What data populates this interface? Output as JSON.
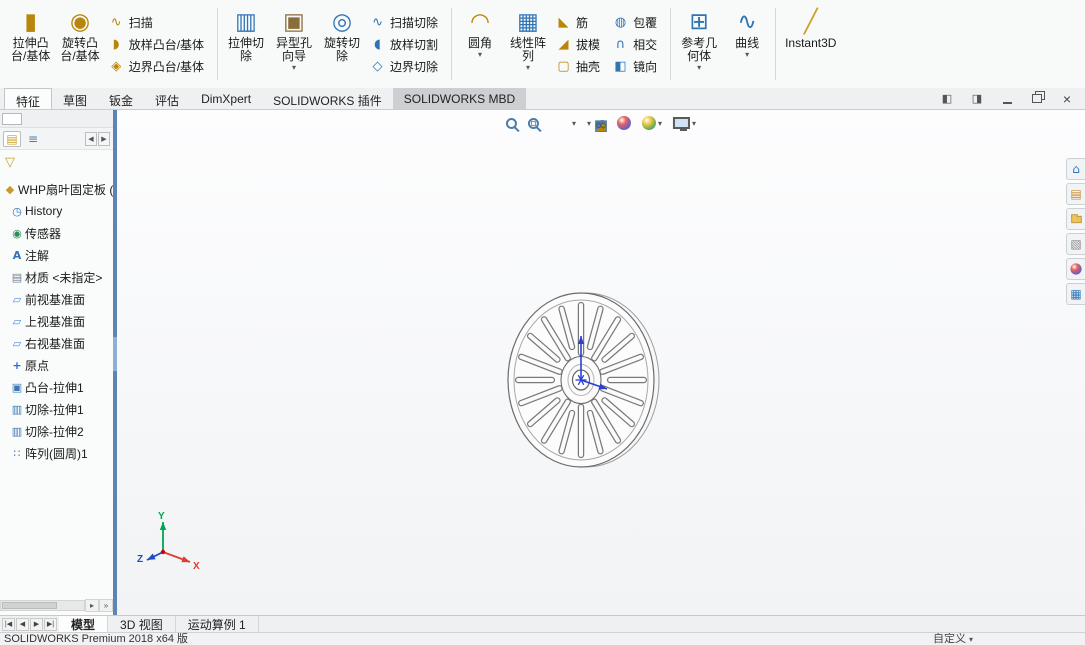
{
  "icons": {
    "filter": "▽",
    "spin_left": "◀",
    "spin_right": "▶",
    "hscroll_right": "▸",
    "overflow": "»",
    "caret": "▾"
  },
  "ribbon": {
    "groups": [
      [
        {
          "kind": "large",
          "id": "extruded-boss",
          "lines": [
            "拉伸凸",
            "台/基体"
          ],
          "glyph": "▮",
          "color": "#b8860b"
        },
        {
          "kind": "large",
          "id": "revolved-boss",
          "lines": [
            "旋转凸",
            "台/基体"
          ],
          "glyph": "◉",
          "color": "#b8860b"
        },
        {
          "kind": "stack",
          "items": [
            {
              "id": "swept-boss",
              "label": "扫描",
              "glyph": "∿",
              "color": "#b8860b"
            },
            {
              "id": "lofted-boss",
              "label": "放样凸台/基体",
              "glyph": "◗",
              "color": "#b8860b"
            },
            {
              "id": "boundary-boss",
              "label": "边界凸台/基体",
              "glyph": "◈",
              "color": "#b8860b"
            }
          ]
        }
      ],
      [
        {
          "kind": "large",
          "id": "extruded-cut",
          "lines": [
            "拉伸切",
            "除"
          ],
          "glyph": "▥",
          "color": "#2e75b6"
        },
        {
          "kind": "large",
          "id": "hole-wizard",
          "lines": [
            "异型孔",
            "向导"
          ],
          "glyph": "▣",
          "color": "#8a6d3b",
          "caret": true
        },
        {
          "kind": "large",
          "id": "revolved-cut",
          "lines": [
            "旋转切",
            "除"
          ],
          "glyph": "◎",
          "color": "#2e75b6"
        },
        {
          "kind": "stack",
          "items": [
            {
              "id": "swept-cut",
              "label": "扫描切除",
              "glyph": "∿",
              "color": "#2e75b6"
            },
            {
              "id": "lofted-cut",
              "label": "放样切割",
              "glyph": "◖",
              "color": "#2e75b6"
            },
            {
              "id": "boundary-cut",
              "label": "边界切除",
              "glyph": "◇",
              "color": "#2e75b6"
            }
          ]
        }
      ],
      [
        {
          "kind": "large",
          "id": "fillet",
          "lines": [
            "圆角"
          ],
          "glyph": "◠",
          "color": "#b8860b",
          "caret": true
        },
        {
          "kind": "large",
          "id": "linear-pattern",
          "lines": [
            "线性阵",
            "列"
          ],
          "glyph": "▦",
          "color": "#2e75b6",
          "caret": true
        },
        {
          "kind": "stack",
          "items": [
            {
              "id": "rib",
              "label": "筋",
              "glyph": "◣",
              "color": "#b8860b"
            },
            {
              "id": "draft",
              "label": "拔模",
              "glyph": "◢",
              "color": "#b8860b"
            },
            {
              "id": "shell",
              "label": "抽壳",
              "glyph": "▢",
              "color": "#b8860b"
            }
          ]
        },
        {
          "kind": "stack",
          "items": [
            {
              "id": "wrap",
              "label": "包覆",
              "glyph": "◍",
              "color": "#2e75b6"
            },
            {
              "id": "intersect",
              "label": "相交",
              "glyph": "∩",
              "color": "#2e75b6"
            },
            {
              "id": "mirror",
              "label": "镜向",
              "glyph": "◧",
              "color": "#2e75b6"
            }
          ]
        }
      ],
      [
        {
          "kind": "large",
          "id": "reference-geometry",
          "lines": [
            "参考几",
            "何体"
          ],
          "glyph": "⊞",
          "color": "#2e75b6",
          "caret": true
        },
        {
          "kind": "large",
          "id": "curves",
          "lines": [
            "曲线"
          ],
          "glyph": "∿",
          "color": "#2e75b6",
          "caret": true
        }
      ],
      [
        {
          "kind": "large",
          "id": "instant3d",
          "lines": [
            "Instant3D"
          ],
          "glyph": "╱",
          "color": "#c9a227"
        }
      ]
    ]
  },
  "tab_bar": {
    "active": 0,
    "tabs": [
      {
        "id": "features",
        "label": "特征"
      },
      {
        "id": "sketch",
        "label": "草图"
      },
      {
        "id": "sheet-metal",
        "label": "钣金"
      },
      {
        "id": "evaluate",
        "label": "评估"
      },
      {
        "id": "dimxpert",
        "label": "DimXpert"
      },
      {
        "id": "addins",
        "label": "SOLIDWORKS 插件"
      },
      {
        "id": "mbd",
        "label": "SOLIDWORKS MBD",
        "shaded": true
      }
    ]
  },
  "window_controls": [
    {
      "id": "collapse-pane"
    },
    {
      "id": "expand-pane"
    },
    {
      "id": "minimize"
    },
    {
      "id": "restore"
    },
    {
      "id": "close"
    }
  ],
  "manager_tabs": [
    {
      "id": "featuremanager-tab",
      "glyph": "▤",
      "color": "#c9a227",
      "active": true
    },
    {
      "id": "displaymanager-tab",
      "glyph": "≡",
      "color": "#4a7dab",
      "active": false
    }
  ],
  "feature_tree": {
    "items": [
      {
        "id": "part-root",
        "icon": "part-icon",
        "glyph": "◆",
        "color": "#c79a2a",
        "label": "WHP扇叶固定板 (",
        "root": true
      },
      {
        "id": "history",
        "icon": "history-icon",
        "glyph": "◷",
        "color": "#2e75b6",
        "label": "History"
      },
      {
        "id": "sensors",
        "icon": "sensors-icon",
        "glyph": "◉",
        "color": "#2e8b57",
        "label": "传感器"
      },
      {
        "id": "annotations",
        "icon": "annotations-icon",
        "glyph": "A",
        "color": "#2e75b6",
        "label": "注解"
      },
      {
        "id": "material",
        "icon": "material-icon",
        "glyph": "▤",
        "color": "#708090",
        "label": "材质 <未指定>"
      },
      {
        "id": "front-plane",
        "icon": "plane-icon",
        "glyph": "▱",
        "color": "#4a90d9",
        "label": "前视基准面"
      },
      {
        "id": "top-plane",
        "icon": "plane-icon",
        "glyph": "▱",
        "color": "#4a90d9",
        "label": "上视基准面"
      },
      {
        "id": "right-plane",
        "icon": "plane-icon",
        "glyph": "▱",
        "color": "#4a90d9",
        "label": "右视基准面"
      },
      {
        "id": "origin",
        "icon": "origin-icon",
        "glyph": "+",
        "color": "#2e6bd8",
        "label": "原点"
      },
      {
        "id": "boss-extrude1",
        "icon": "boss-extrude-icon",
        "glyph": "▣",
        "color": "#3b77b0",
        "label": "凸台-拉伸1"
      },
      {
        "id": "cut-extrude1",
        "icon": "cut-extrude-icon",
        "glyph": "▥",
        "color": "#3b77b0",
        "label": "切除-拉伸1"
      },
      {
        "id": "cut-extrude2",
        "icon": "cut-extrude-icon",
        "glyph": "▥",
        "color": "#3b77b0",
        "label": "切除-拉伸2"
      },
      {
        "id": "circular-pattern1",
        "icon": "circular-pattern-icon",
        "glyph": "∷",
        "color": "#3b77b0",
        "label": "阵列(圆周)1"
      }
    ]
  },
  "viewport": {
    "headsup": [
      {
        "id": "zoom-fit",
        "css": "mag"
      },
      {
        "id": "zoom-area",
        "css": "mag area"
      },
      {
        "id": "previous-view",
        "glyph": "↶",
        "color": "#4a7dab"
      },
      {
        "id": "section-view",
        "glyph": "◪",
        "color": "#b8860b"
      },
      {
        "id": "view-orientation",
        "glyph": "◰",
        "color": "#4a7dab",
        "caret": true
      },
      {
        "id": "display-style",
        "glyph": "◩",
        "color": "#4a7dab",
        "caret": true
      },
      {
        "id": "hide-show-items",
        "glyph": "∞",
        "color": "#555555",
        "caret": true
      },
      {
        "id": "edit-appearance",
        "css": "ball"
      },
      {
        "id": "apply-scene",
        "css": "ball scene",
        "caret": true
      },
      {
        "id": "view-settings",
        "css": "mon",
        "caret": true
      }
    ]
  },
  "task_pane": [
    {
      "id": "resources",
      "glyph": "⌂",
      "color": "#2e75b6"
    },
    {
      "id": "design-library",
      "glyph": "▤",
      "color": "#c98a2a"
    },
    {
      "id": "file-explorer",
      "css": "folder"
    },
    {
      "id": "view-palette",
      "glyph": "▧",
      "color": "#888888"
    },
    {
      "id": "appearances",
      "css": "ball"
    },
    {
      "id": "custom-properties",
      "glyph": "▦",
      "color": "#2e75b6"
    }
  ],
  "triad": {
    "x": "X",
    "y": "Y",
    "z": "Z"
  },
  "sheet_bar": {
    "nav": [
      "|◀",
      "◀",
      "▶",
      "▶|"
    ],
    "tabs": [
      {
        "id": "model",
        "label": "模型",
        "active": true
      },
      {
        "id": "3d-views",
        "label": "3D 视图"
      },
      {
        "id": "motion-study-1",
        "label": "运动算例 1"
      }
    ]
  },
  "status_bar": {
    "left": "SOLIDWORKS Premium 2018 x64 版",
    "right": "自定义"
  }
}
